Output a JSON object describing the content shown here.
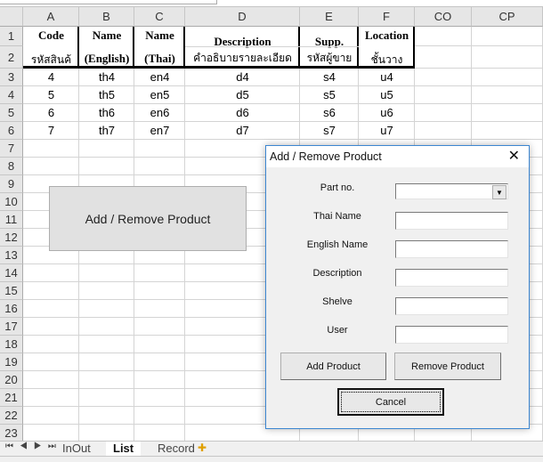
{
  "columns": [
    "A",
    "B",
    "C",
    "D",
    "E",
    "F",
    "CO",
    "CP"
  ],
  "header_row1": [
    "Code",
    "Name",
    "Name",
    "Description",
    "Supp.",
    "Location"
  ],
  "header_row2": [
    "รหัสสินค้",
    "(English)",
    "(Thai)",
    "คำอธิบายรายละเอียด",
    "รหัสผู้ขาย",
    "ชั้นวาง"
  ],
  "row_numbers": [
    "1",
    "2",
    "3",
    "4",
    "5",
    "6",
    "7",
    "8",
    "9",
    "10",
    "11",
    "12",
    "13",
    "14",
    "15",
    "16",
    "17",
    "18",
    "19",
    "20",
    "21",
    "22",
    "23"
  ],
  "data_rows": [
    [
      "4",
      "th4",
      "en4",
      "d4",
      "s4",
      "u4"
    ],
    [
      "5",
      "th5",
      "en5",
      "d5",
      "s5",
      "u5"
    ],
    [
      "6",
      "th6",
      "en6",
      "d6",
      "s6",
      "u6"
    ],
    [
      "7",
      "th7",
      "en7",
      "d7",
      "s7",
      "u7"
    ]
  ],
  "sheet_button": "Add / Remove Product",
  "sheet_tabs": [
    {
      "label": "InOut",
      "active": false
    },
    {
      "label": "List",
      "active": true
    },
    {
      "label": "Record",
      "active": false
    }
  ],
  "dialog": {
    "title": "Add / Remove Product",
    "fields": [
      {
        "label": "Part no.",
        "value": "",
        "type": "combo"
      },
      {
        "label": "Thai Name",
        "value": ""
      },
      {
        "label": "English Name",
        "value": ""
      },
      {
        "label": "Description",
        "value": ""
      },
      {
        "label": "Shelve",
        "value": ""
      },
      {
        "label": "User",
        "value": ""
      }
    ],
    "add_button": "Add Product",
    "remove_button": "Remove Product",
    "cancel_button": "Cancel"
  }
}
